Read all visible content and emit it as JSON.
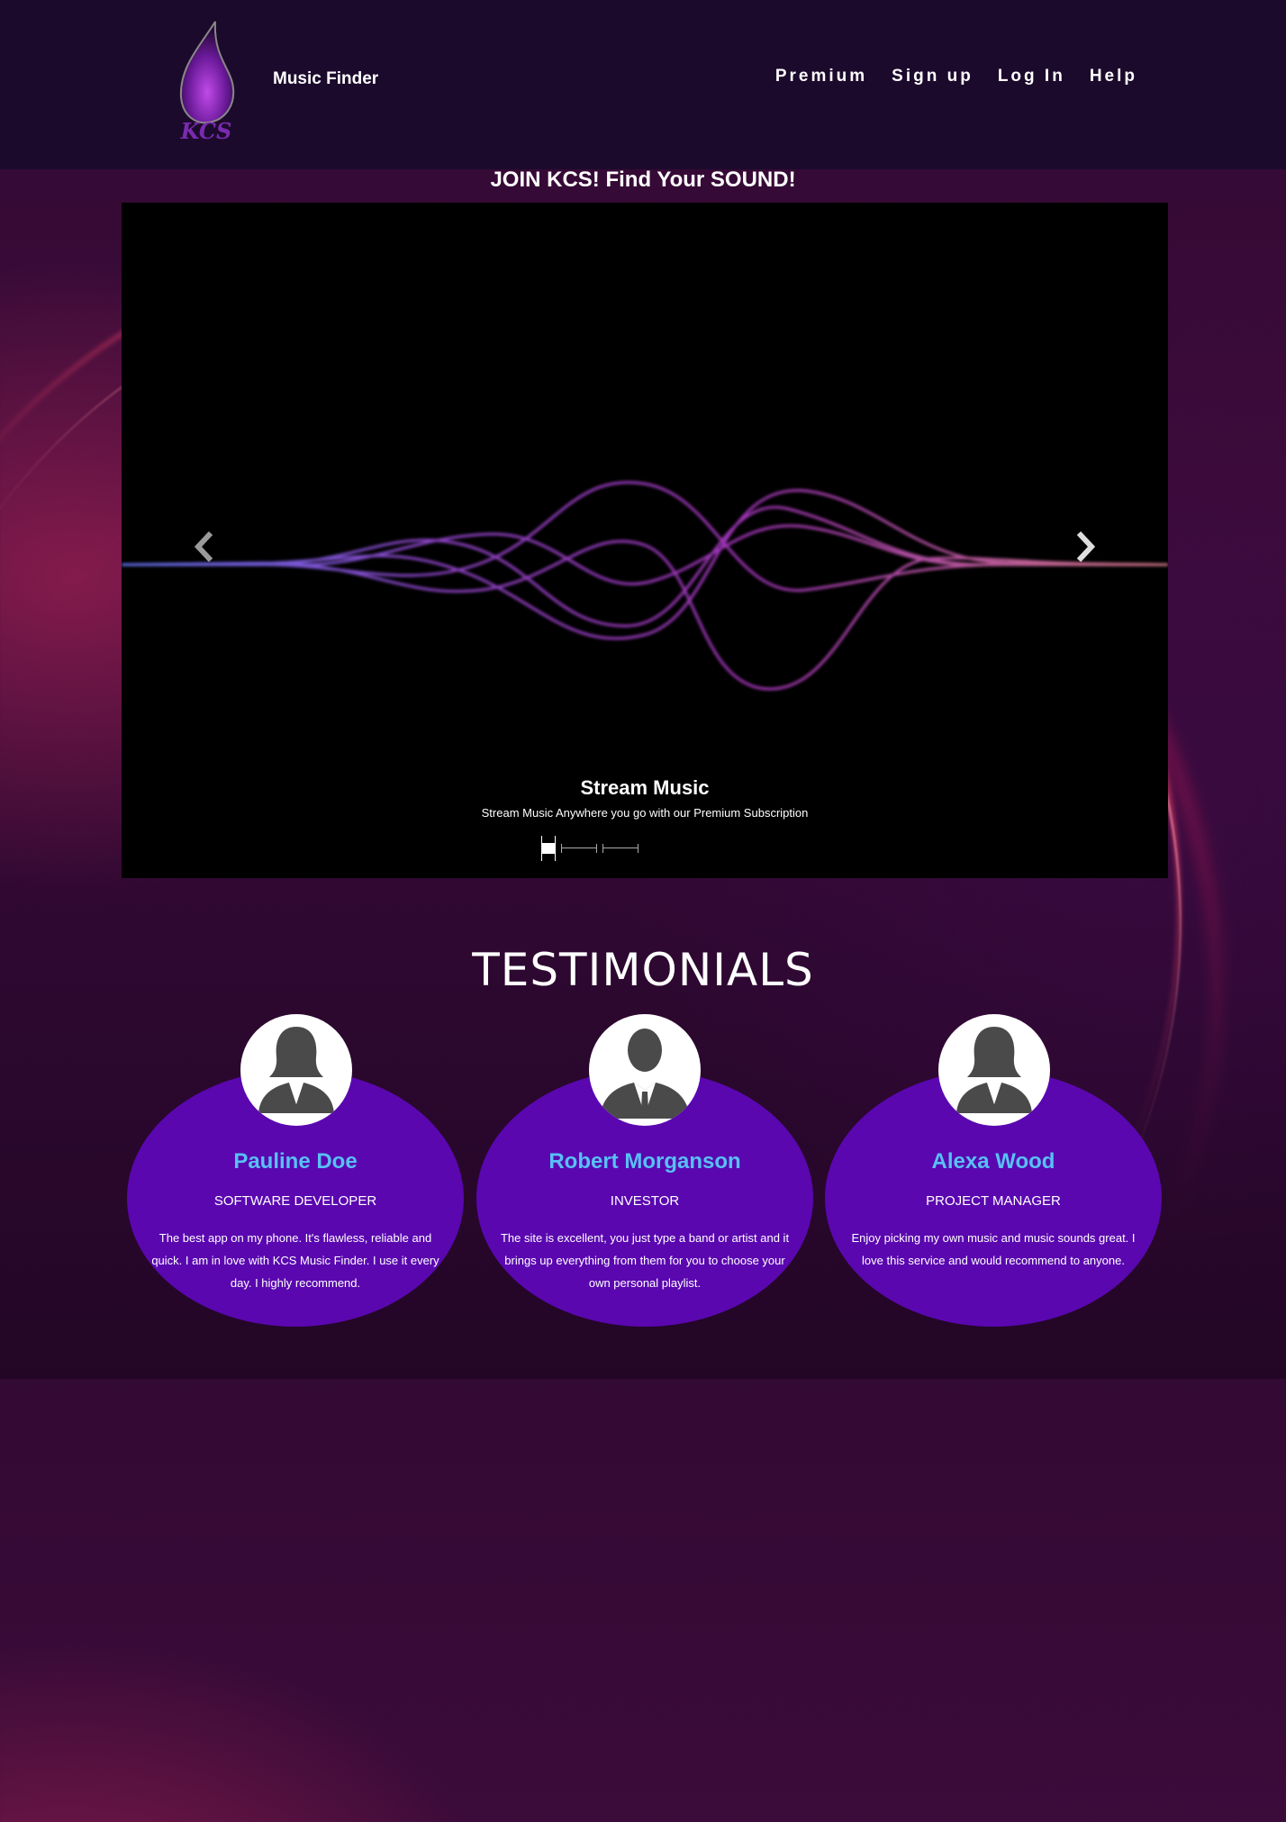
{
  "header": {
    "logo_text": "KCS",
    "brand": "Music Finder",
    "nav": [
      "Premium",
      "Sign up",
      "Log In",
      "Help"
    ]
  },
  "hero": {
    "heading": "JOIN KCS! Find Your SOUND!"
  },
  "carousel": {
    "slide_title": "Stream Music",
    "slide_text": "Stream Music Anywhere you go with our Premium Subscription",
    "slide_count": 3,
    "active_index": 0
  },
  "testimonials": {
    "title": "TESTIMONIALS",
    "items": [
      {
        "name": "Pauline Doe",
        "role": "SOFTWARE DEVELOPER",
        "quote": "The best app on my phone. It's flawless, reliable and quick. I am in love with KCS Music Finder. I use it every day. I highly recommend.",
        "avatar": "female-avatar-icon"
      },
      {
        "name": "Robert Morganson",
        "role": "INVESTOR",
        "quote": "The site is excellent, you just type a band or artist and it brings up everything from them for you to choose your own personal playlist.",
        "avatar": "male-avatar-icon"
      },
      {
        "name": "Alexa Wood",
        "role": "PROJECT MANAGER",
        "quote": "Enjoy picking my own music and music sounds great. I love this service and would recommend to anyone.",
        "avatar": "female-avatar-icon"
      }
    ]
  },
  "colors": {
    "header_bg": "#1c0a2c",
    "card_bg": "#5a07b0",
    "name_color": "#58c0f5"
  }
}
